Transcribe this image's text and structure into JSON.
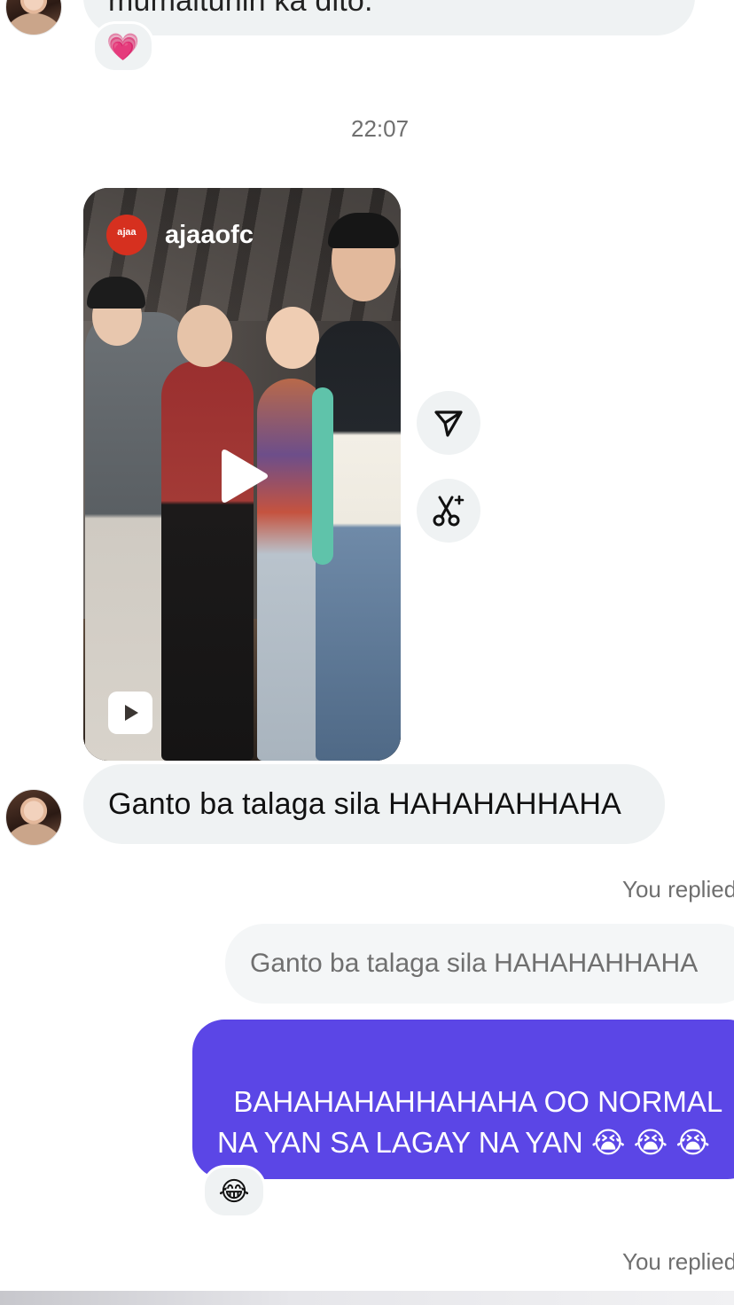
{
  "thread": {
    "top_message_partial": "mumaltunin ka dito.",
    "top_reaction": "💗",
    "timestamp": "22:07",
    "reel": {
      "author": "ajaaofc",
      "logo_text": "ᵃʲᵃᵃ"
    },
    "incoming_message": "Ganto ba talaga sila HAHAHAHHAHA",
    "reply1": {
      "label": "You replied",
      "quoted": "Ganto ba talaga sila HAHAHAHHAHA",
      "message": "BAHAHAHAHHAHAHA OO NORMAL\nNA YAN SA LAGAY NA YAN 😭 😭 😭\n😭",
      "reaction": "😂"
    },
    "reply2_label": "You replied"
  },
  "icons": {
    "share": "share-icon",
    "remix": "remix-scissors-icon",
    "play": "play-icon",
    "reel_badge": "reels-icon"
  }
}
